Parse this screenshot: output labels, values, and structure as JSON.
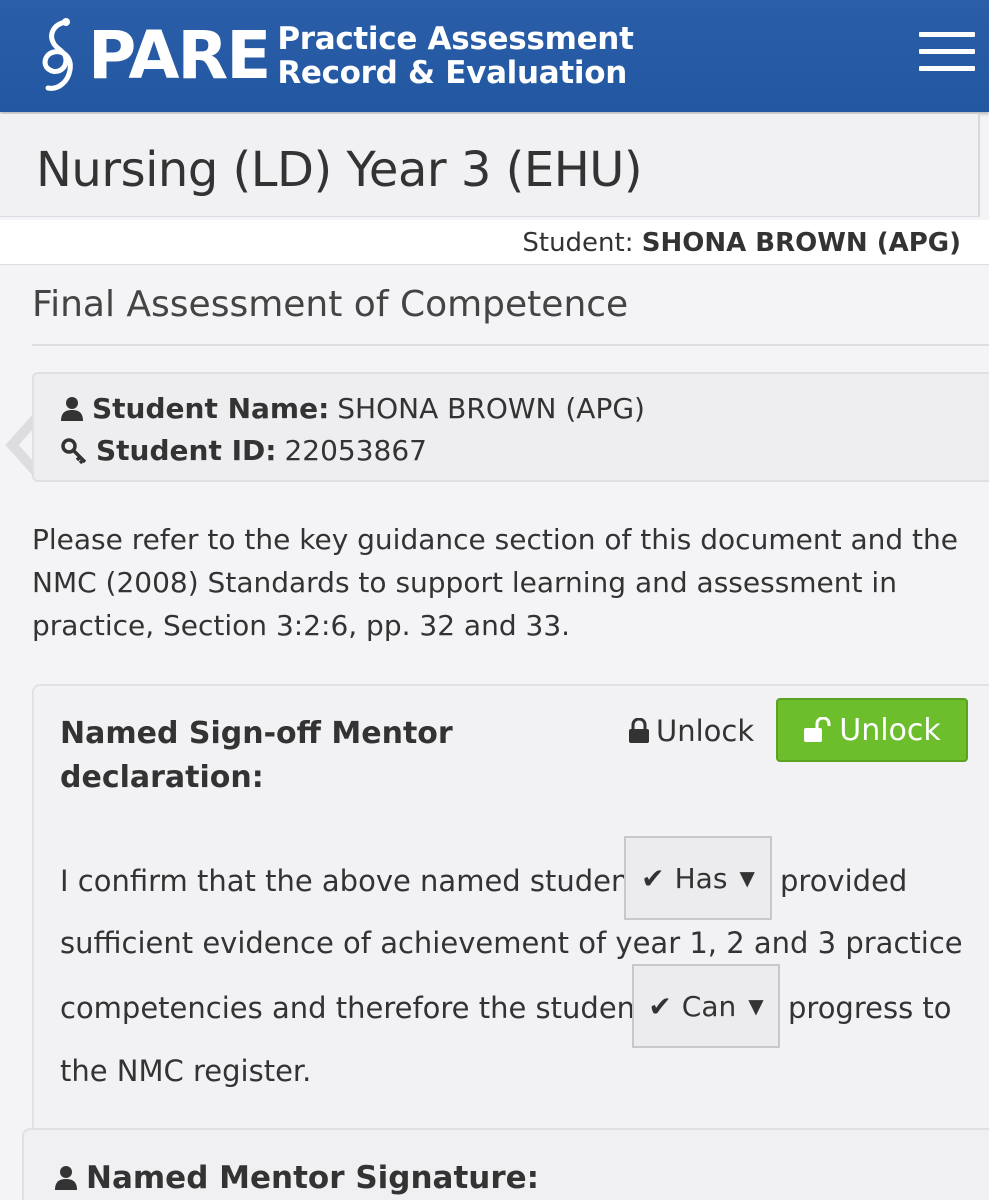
{
  "header": {
    "logo_word": "PARE",
    "logo_line1": "Practice Assessment",
    "logo_line2": "Record & Evaluation",
    "bg_color": "#2257a2",
    "menu_icon": "hamburger-menu-icon"
  },
  "course": {
    "title": "Nursing (LD) Year 3 (EHU)"
  },
  "student_bar": {
    "label": "Student:",
    "name": "SHONA BROWN (APG)"
  },
  "section": {
    "title": "Final Assessment of Competence"
  },
  "info": {
    "name_label": "Student Name:",
    "name_value": "SHONA BROWN (APG)",
    "id_label": "Student ID:",
    "id_value": "22053867"
  },
  "guidance": {
    "text": "Please refer to the key guidance section of this document and the NMC (2008) Standards to support learning and assessment in practice, Section 3:2:6, pp. 32 and 33."
  },
  "declaration": {
    "title": "Named Sign-off Mentor declaration:",
    "lock_label": "Unlock",
    "unlock_button": "Unlock",
    "unlock_color": "#6cbe2c",
    "line1_before": "I confirm that the above named student",
    "select1_value": "Has",
    "line1_after": "provided",
    "line2": "sufficient evidence of achievement of year 1, 2 and 3 practice",
    "line3_before": "competencies and therefore the student",
    "select2_value": "Can",
    "line3_after": "progress to",
    "line4": "the NMC register."
  },
  "signature": {
    "title": "Named Mentor Signature:"
  }
}
